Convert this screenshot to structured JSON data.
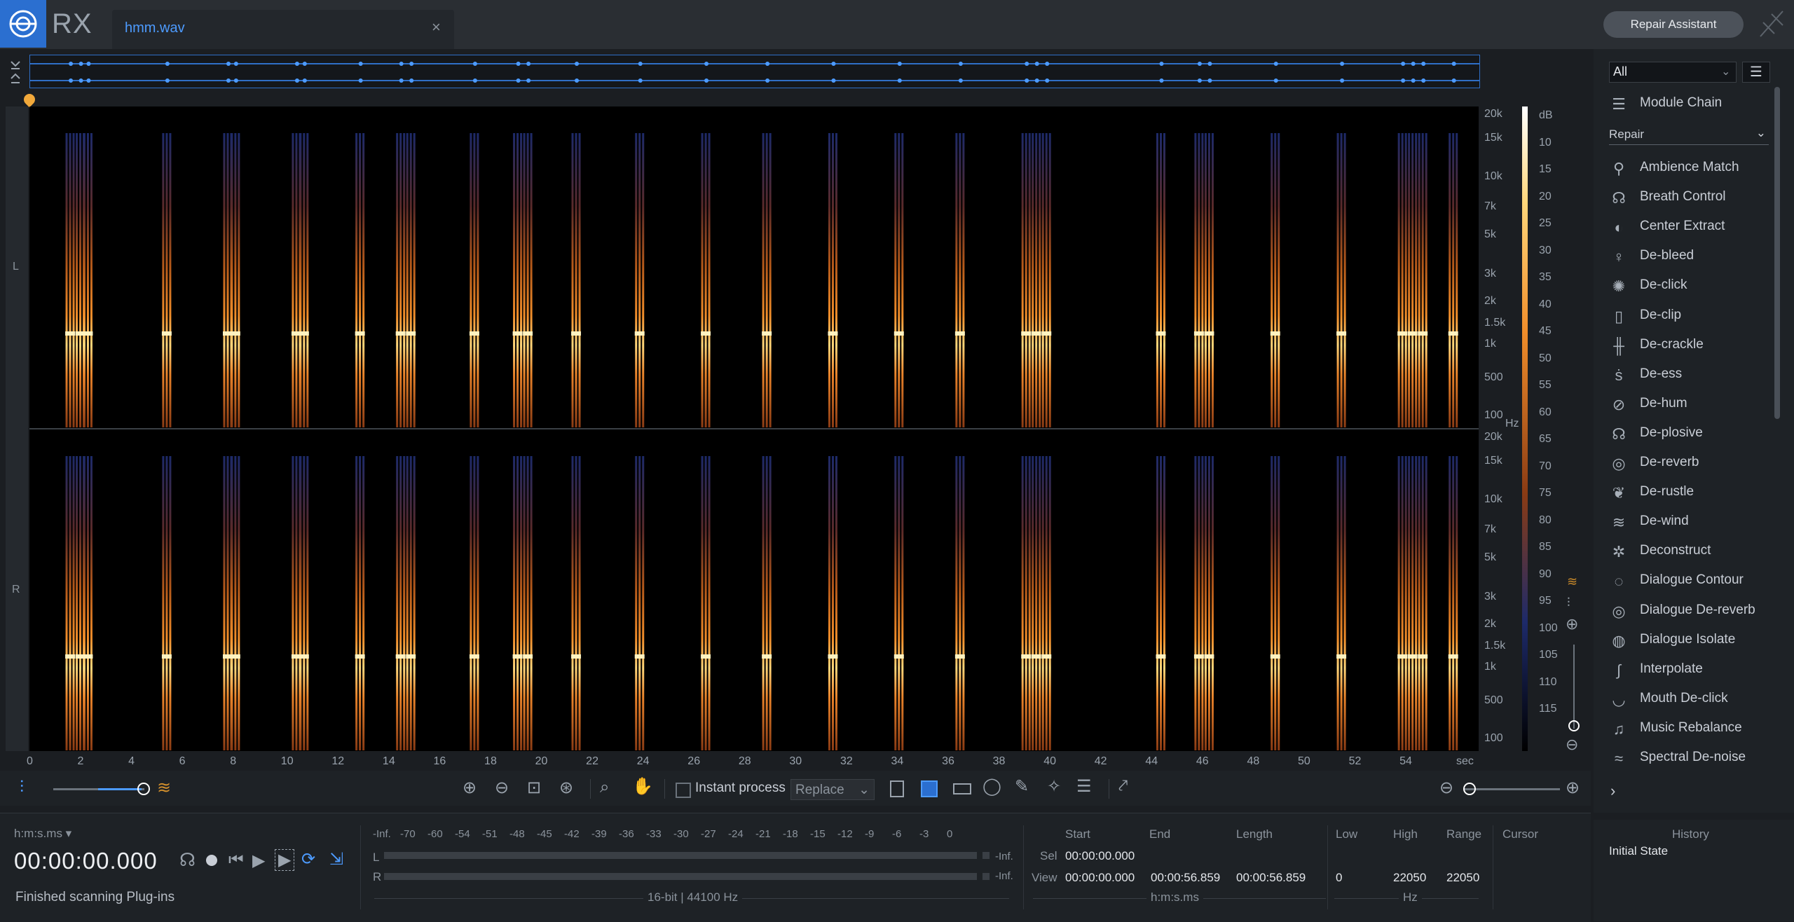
{
  "app": {
    "name": "RX",
    "file_tab": "hmm.wav",
    "close_glyph": "×",
    "repair_assistant": "Repair Assistant"
  },
  "overview": {
    "collapse_glyph": "⌄"
  },
  "channels": {
    "left": "L",
    "right": "R"
  },
  "freq_axis": {
    "labels": [
      "20k",
      "15k",
      "10k",
      "7k",
      "5k",
      "3k",
      "2k",
      "1.5k",
      "1k",
      "500",
      "100"
    ],
    "unit": "Hz"
  },
  "db_axis": {
    "labels": [
      "dB",
      "10",
      "15",
      "20",
      "25",
      "30",
      "35",
      "40",
      "45",
      "50",
      "55",
      "60",
      "65",
      "70",
      "75",
      "80",
      "85",
      "90",
      "95",
      "100",
      "105",
      "110",
      "115"
    ]
  },
  "time_axis": {
    "labels": [
      "0",
      "2",
      "4",
      "6",
      "8",
      "10",
      "12",
      "14",
      "16",
      "18",
      "20",
      "22",
      "24",
      "26",
      "28",
      "30",
      "32",
      "34",
      "36",
      "38",
      "40",
      "42",
      "44",
      "46",
      "48",
      "50",
      "52",
      "54"
    ],
    "unit": "sec"
  },
  "bursts_sec": [
    1.6,
    2.0,
    2.3,
    5.4,
    7.8,
    8.1,
    10.5,
    10.8,
    13.0,
    14.6,
    15.0,
    17.5,
    19.2,
    19.6,
    21.5,
    24.0,
    26.6,
    29.0,
    31.6,
    34.2,
    36.6,
    39.2,
    39.6,
    40.0,
    44.5,
    46.0,
    46.4,
    49.0,
    51.6,
    54.0,
    54.4,
    54.8,
    56.0
  ],
  "toolbar": {
    "instant_process": "Instant process",
    "mode": "Replace"
  },
  "transport": {
    "time_format": "h:m:s.ms",
    "timecode": "00:00:00.000",
    "status": "Finished scanning Plug-ins"
  },
  "meter": {
    "scale": [
      "-Inf.",
      "-70",
      "-60",
      "-54",
      "-51",
      "-48",
      "-45",
      "-42",
      "-39",
      "-36",
      "-33",
      "-30",
      "-27",
      "-24",
      "-21",
      "-18",
      "-15",
      "-12",
      "-9",
      "-6",
      "-3",
      "0"
    ],
    "left_label": "L",
    "right_label": "R",
    "left_value": "-Inf.",
    "right_value": "-Inf.",
    "format": "16-bit | 44100 Hz"
  },
  "selection": {
    "headers": {
      "start": "Start",
      "end": "End",
      "length": "Length",
      "low": "Low",
      "high": "High",
      "range": "Range",
      "cursor": "Cursor"
    },
    "sel_label": "Sel",
    "view_label": "View",
    "sel_start": "00:00:00.000",
    "view_start": "00:00:00.000",
    "view_end": "00:00:56.859",
    "view_length": "00:00:56.859",
    "time_unit": "h:m:s.ms",
    "low": "0",
    "high": "22050",
    "range": "22050",
    "freq_unit": "Hz"
  },
  "modules": {
    "filter": "All",
    "module_chain": "Module Chain",
    "category": "Repair",
    "items": [
      {
        "label": "Ambience Match",
        "icon": "ambience-match-icon",
        "glyph": "⚲"
      },
      {
        "label": "Breath Control",
        "icon": "breath-control-icon",
        "glyph": "☊"
      },
      {
        "label": "Center Extract",
        "icon": "center-extract-icon",
        "glyph": "◐"
      },
      {
        "label": "De-bleed",
        "icon": "de-bleed-icon",
        "glyph": "♀"
      },
      {
        "label": "De-click",
        "icon": "de-click-icon",
        "glyph": "✺"
      },
      {
        "label": "De-clip",
        "icon": "de-clip-icon",
        "glyph": "▯"
      },
      {
        "label": "De-crackle",
        "icon": "de-crackle-icon",
        "glyph": "╫"
      },
      {
        "label": "De-ess",
        "icon": "de-ess-icon",
        "glyph": "ṡ"
      },
      {
        "label": "De-hum",
        "icon": "de-hum-icon",
        "glyph": "⊘"
      },
      {
        "label": "De-plosive",
        "icon": "de-plosive-icon",
        "glyph": "☊"
      },
      {
        "label": "De-reverb",
        "icon": "de-reverb-icon",
        "glyph": "◎"
      },
      {
        "label": "De-rustle",
        "icon": "de-rustle-icon",
        "glyph": "❦"
      },
      {
        "label": "De-wind",
        "icon": "de-wind-icon",
        "glyph": "≋"
      },
      {
        "label": "Deconstruct",
        "icon": "deconstruct-icon",
        "glyph": "✲"
      },
      {
        "label": "Dialogue Contour",
        "icon": "dialogue-contour-icon",
        "glyph": "◌"
      },
      {
        "label": "Dialogue De-reverb",
        "icon": "dialogue-de-reverb-icon",
        "glyph": "◎"
      },
      {
        "label": "Dialogue Isolate",
        "icon": "dialogue-isolate-icon",
        "glyph": "◍"
      },
      {
        "label": "Interpolate",
        "icon": "interpolate-icon",
        "glyph": "∫"
      },
      {
        "label": "Mouth De-click",
        "icon": "mouth-de-click-icon",
        "glyph": "◡"
      },
      {
        "label": "Music Rebalance",
        "icon": "music-rebalance-icon",
        "glyph": "♫"
      },
      {
        "label": "Spectral De-noise",
        "icon": "spectral-de-noise-icon",
        "glyph": "≈"
      }
    ]
  },
  "history": {
    "title": "History",
    "entries": [
      "Initial State"
    ]
  }
}
